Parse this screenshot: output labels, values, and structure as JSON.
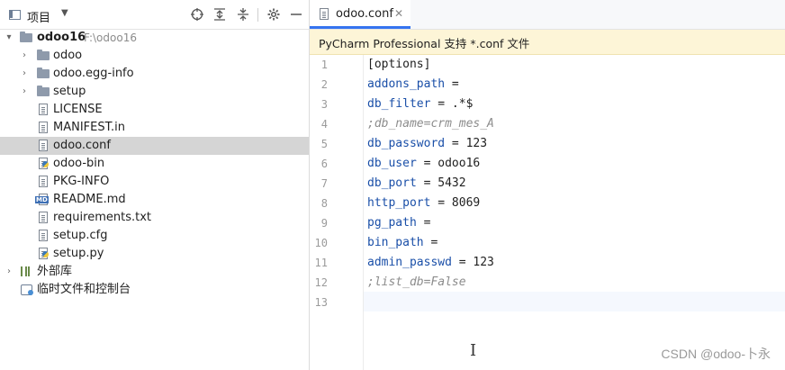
{
  "project_panel": {
    "title": "项目",
    "tree": [
      {
        "label": "odoo16",
        "hint": "F:\\odoo16",
        "kind": "root"
      },
      {
        "label": "odoo",
        "kind": "folder"
      },
      {
        "label": "odoo.egg-info",
        "kind": "folder"
      },
      {
        "label": "setup",
        "kind": "folder"
      },
      {
        "label": "LICENSE",
        "kind": "file"
      },
      {
        "label": "MANIFEST.in",
        "kind": "file"
      },
      {
        "label": "odoo.conf",
        "kind": "file",
        "selected": true
      },
      {
        "label": "odoo-bin",
        "kind": "python"
      },
      {
        "label": "PKG-INFO",
        "kind": "file"
      },
      {
        "label": "README.md",
        "kind": "markdown"
      },
      {
        "label": "requirements.txt",
        "kind": "file"
      },
      {
        "label": "setup.cfg",
        "kind": "file"
      },
      {
        "label": "setup.py",
        "kind": "python"
      },
      {
        "label": "外部库",
        "kind": "library"
      },
      {
        "label": "临时文件和控制台",
        "kind": "scratch"
      }
    ]
  },
  "editor": {
    "tab_label": "odoo.conf",
    "banner": "PyCharm Professional 支持 *.conf 文件",
    "current_line": 13,
    "lines": [
      {
        "n": "1",
        "key": "[options]",
        "val": ""
      },
      {
        "n": "2",
        "key": "addons_path",
        "val": " ="
      },
      {
        "n": "3",
        "key": "db_filter",
        "val": " = .*$"
      },
      {
        "n": "4",
        "comment": ";db_name=crm_mes_A"
      },
      {
        "n": "5",
        "key": "db_password",
        "val": " = 123"
      },
      {
        "n": "6",
        "key": "db_user",
        "val": " = odoo16"
      },
      {
        "n": "7",
        "key": "db_port",
        "val": " = 5432"
      },
      {
        "n": "8",
        "key": "http_port",
        "val": " = 8069"
      },
      {
        "n": "9",
        "key": "pg_path",
        "val": " ="
      },
      {
        "n": "10",
        "key": "bin_path",
        "val": " ="
      },
      {
        "n": "11",
        "key": "admin_passwd",
        "val": " = 123"
      },
      {
        "n": "12",
        "comment": ";list_db=False"
      },
      {
        "n": "13",
        "key": "",
        "val": ""
      }
    ]
  },
  "watermark": "CSDN @odoo-卜永",
  "colors": {
    "accent": "#3574f0",
    "selection": "#d5d5d5",
    "banner": "#fdf5d7",
    "key": "#1a4fa8"
  }
}
